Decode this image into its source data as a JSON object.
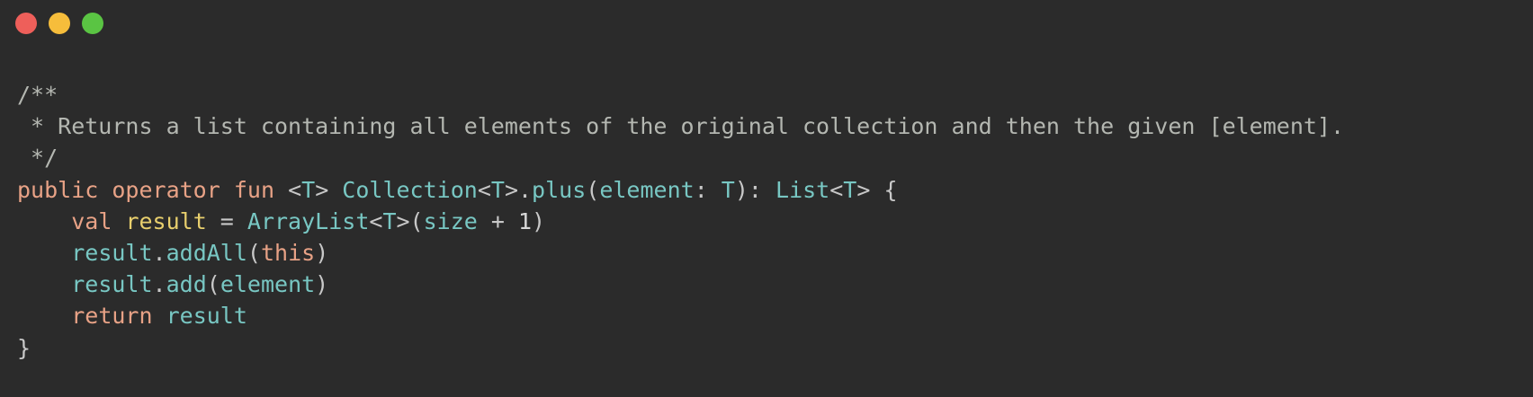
{
  "window": {
    "buttons": [
      {
        "name": "close",
        "color": "#ee5f5a"
      },
      {
        "name": "minimize",
        "color": "#f6bd3b"
      },
      {
        "name": "zoom",
        "color": "#5ac443"
      }
    ]
  },
  "theme": {
    "background": "#2b2b2b",
    "comment": "#b4b7b1",
    "keyword": "#e8a286",
    "type": "#78c7c3",
    "variable": "#e8cf6d"
  },
  "code": {
    "lines": [
      {
        "tokens": [
          {
            "t": "/**",
            "k": "c"
          }
        ]
      },
      {
        "tokens": [
          {
            "t": " * Returns a list containing all elements of the original collection and then the given [element].",
            "k": "c"
          }
        ]
      },
      {
        "tokens": [
          {
            "t": " */",
            "k": "c"
          }
        ]
      },
      {
        "tokens": [
          {
            "t": "public",
            "k": "kw"
          },
          {
            "t": " ",
            "k": "p"
          },
          {
            "t": "operator",
            "k": "kw"
          },
          {
            "t": " ",
            "k": "p"
          },
          {
            "t": "fun",
            "k": "kw"
          },
          {
            "t": " <",
            "k": "p"
          },
          {
            "t": "T",
            "k": "ty"
          },
          {
            "t": "> ",
            "k": "p"
          },
          {
            "t": "Collection",
            "k": "ty"
          },
          {
            "t": "<",
            "k": "p"
          },
          {
            "t": "T",
            "k": "ty"
          },
          {
            "t": ">.",
            "k": "p"
          },
          {
            "t": "plus",
            "k": "ty"
          },
          {
            "t": "(",
            "k": "p"
          },
          {
            "t": "element",
            "k": "ty"
          },
          {
            "t": ": ",
            "k": "p"
          },
          {
            "t": "T",
            "k": "ty"
          },
          {
            "t": "): ",
            "k": "p"
          },
          {
            "t": "List",
            "k": "ty"
          },
          {
            "t": "<",
            "k": "p"
          },
          {
            "t": "T",
            "k": "ty"
          },
          {
            "t": "> {",
            "k": "p"
          }
        ]
      },
      {
        "tokens": [
          {
            "t": "    ",
            "k": "p"
          },
          {
            "t": "val",
            "k": "kw"
          },
          {
            "t": " ",
            "k": "p"
          },
          {
            "t": "result",
            "k": "vr"
          },
          {
            "t": " = ",
            "k": "p"
          },
          {
            "t": "ArrayList",
            "k": "ty"
          },
          {
            "t": "<",
            "k": "p"
          },
          {
            "t": "T",
            "k": "ty"
          },
          {
            "t": ">(",
            "k": "p"
          },
          {
            "t": "size",
            "k": "ty"
          },
          {
            "t": " + ",
            "k": "p"
          },
          {
            "t": "1",
            "k": "nm"
          },
          {
            "t": ")",
            "k": "p"
          }
        ]
      },
      {
        "tokens": [
          {
            "t": "    ",
            "k": "p"
          },
          {
            "t": "result",
            "k": "ty"
          },
          {
            "t": ".",
            "k": "p"
          },
          {
            "t": "addAll",
            "k": "ty"
          },
          {
            "t": "(",
            "k": "p"
          },
          {
            "t": "this",
            "k": "kw"
          },
          {
            "t": ")",
            "k": "p"
          }
        ]
      },
      {
        "tokens": [
          {
            "t": "    ",
            "k": "p"
          },
          {
            "t": "result",
            "k": "ty"
          },
          {
            "t": ".",
            "k": "p"
          },
          {
            "t": "add",
            "k": "ty"
          },
          {
            "t": "(",
            "k": "p"
          },
          {
            "t": "element",
            "k": "ty"
          },
          {
            "t": ")",
            "k": "p"
          }
        ]
      },
      {
        "tokens": [
          {
            "t": "    ",
            "k": "p"
          },
          {
            "t": "return",
            "k": "kw"
          },
          {
            "t": " ",
            "k": "p"
          },
          {
            "t": "result",
            "k": "ty"
          }
        ]
      },
      {
        "tokens": [
          {
            "t": "}",
            "k": "p"
          }
        ]
      }
    ]
  }
}
